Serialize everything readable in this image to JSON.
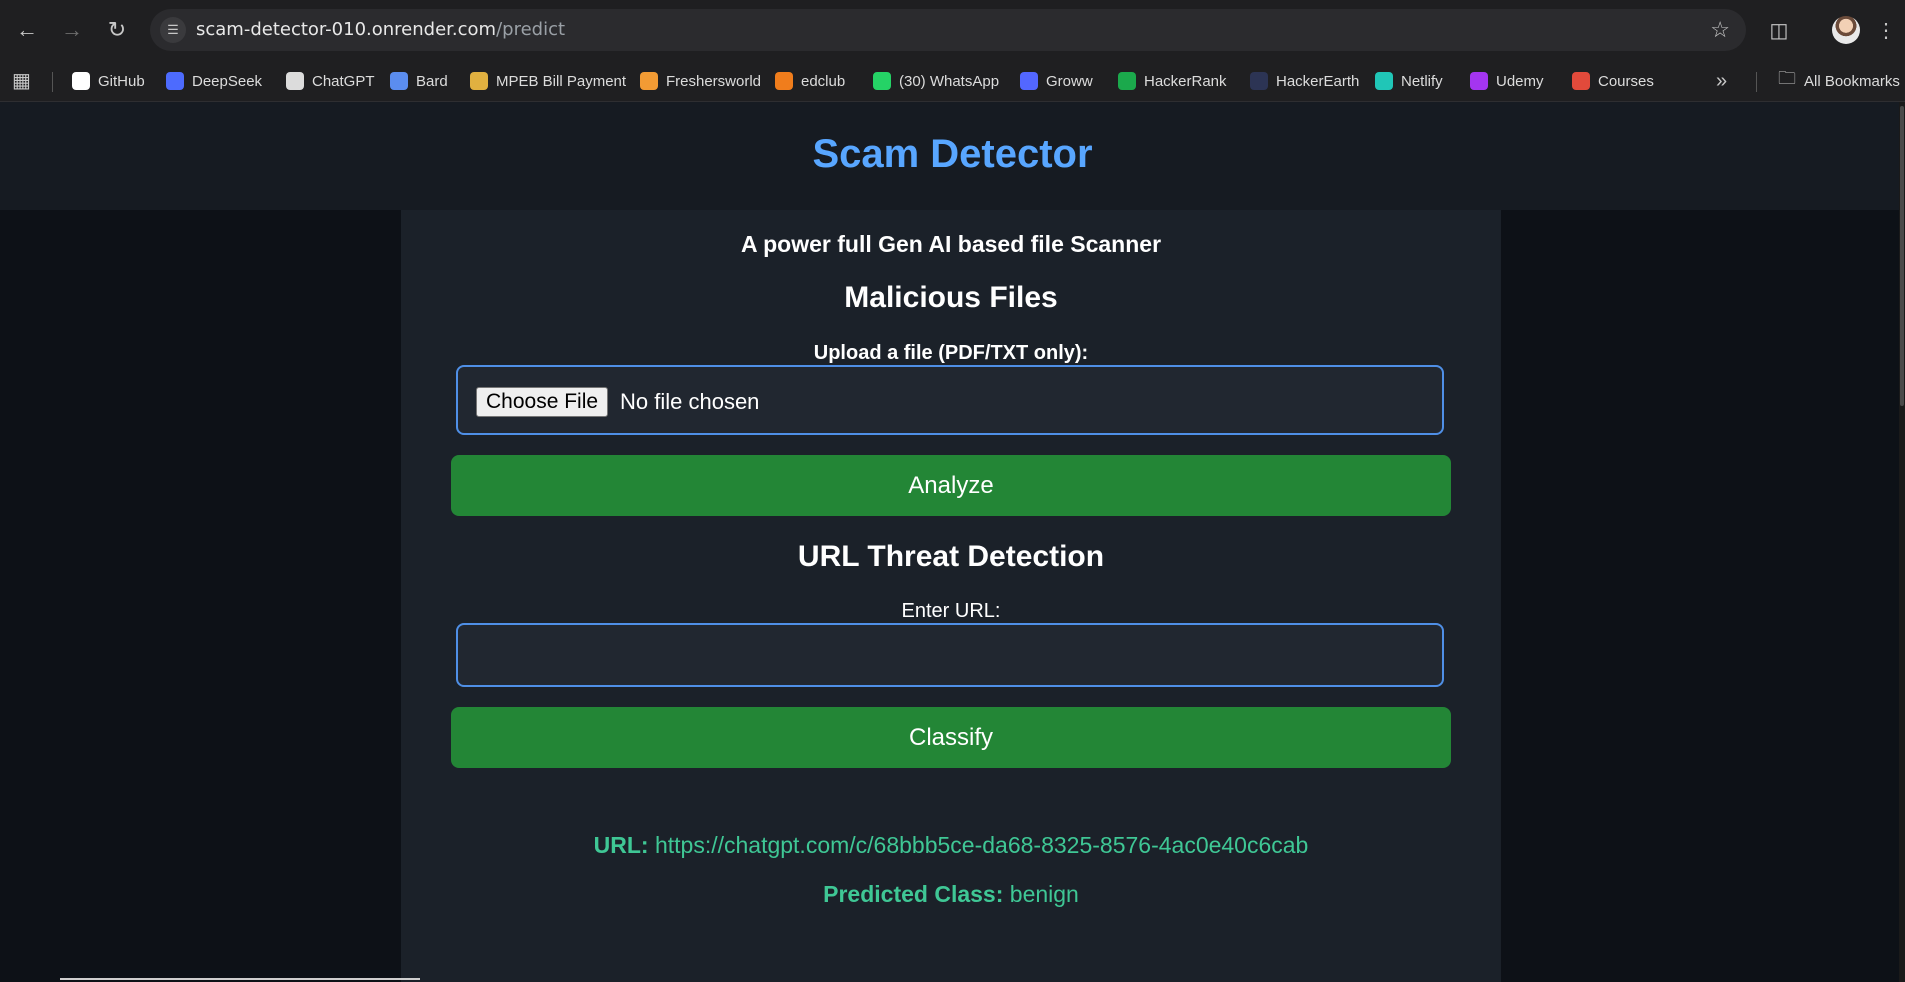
{
  "browser": {
    "url_host": "scam-detector-010.onrender.com",
    "url_path": "/predict",
    "bookmarks": [
      {
        "label": "GitHub",
        "icon": "github-icon",
        "color": "#ffffff"
      },
      {
        "label": "DeepSeek",
        "icon": "deepseek-icon",
        "color": "#4d6bfe"
      },
      {
        "label": "ChatGPT",
        "icon": "chatgpt-icon",
        "color": "#dcdcdc"
      },
      {
        "label": "Bard",
        "icon": "bard-icon",
        "color": "#5b8def"
      },
      {
        "label": "MPEB Bill Payment",
        "icon": "mpeb-icon",
        "color": "#e0b040"
      },
      {
        "label": "Freshersworld",
        "icon": "freshersworld-icon",
        "color": "#f29b34"
      },
      {
        "label": "edclub",
        "icon": "edclub-icon",
        "color": "#f07d1c"
      },
      {
        "label": "(30) WhatsApp",
        "icon": "whatsapp-icon",
        "color": "#25d366"
      },
      {
        "label": "Groww",
        "icon": "groww-icon",
        "color": "#5367ff"
      },
      {
        "label": "HackerRank",
        "icon": "hackerrank-icon",
        "color": "#1ba94c"
      },
      {
        "label": "HackerEarth",
        "icon": "hackerearth-icon",
        "color": "#2c3454"
      },
      {
        "label": "Netlify",
        "icon": "netlify-icon",
        "color": "#20c6b7"
      },
      {
        "label": "Udemy",
        "icon": "udemy-icon",
        "color": "#a435f0"
      },
      {
        "label": "Courses",
        "icon": "courses-icon",
        "color": "#e24a3b"
      }
    ],
    "all_bookmarks": "All Bookmarks"
  },
  "page": {
    "title": "Scam Detector",
    "subtitle": "A power full Gen AI based file Scanner",
    "files_heading": "Malicious Files",
    "upload_label": "Upload a file (PDF/TXT only):",
    "choose_file": "Choose File",
    "no_file": "No file chosen",
    "analyze_label": "Analyze",
    "url_heading": "URL Threat Detection",
    "url_label": "Enter URL:",
    "url_value": "",
    "classify_label": "Classify",
    "result_url_key": "URL:",
    "result_url_value": "https://chatgpt.com/c/68bbb5ce-da68-8325-8576-4ac0e40c6cab",
    "result_class_key": "Predicted Class:",
    "result_class_value": "benign"
  },
  "colors": {
    "accent": "#58a6ff",
    "button": "#238636",
    "result": "#3fc795",
    "field_border": "#4f8fe6"
  }
}
